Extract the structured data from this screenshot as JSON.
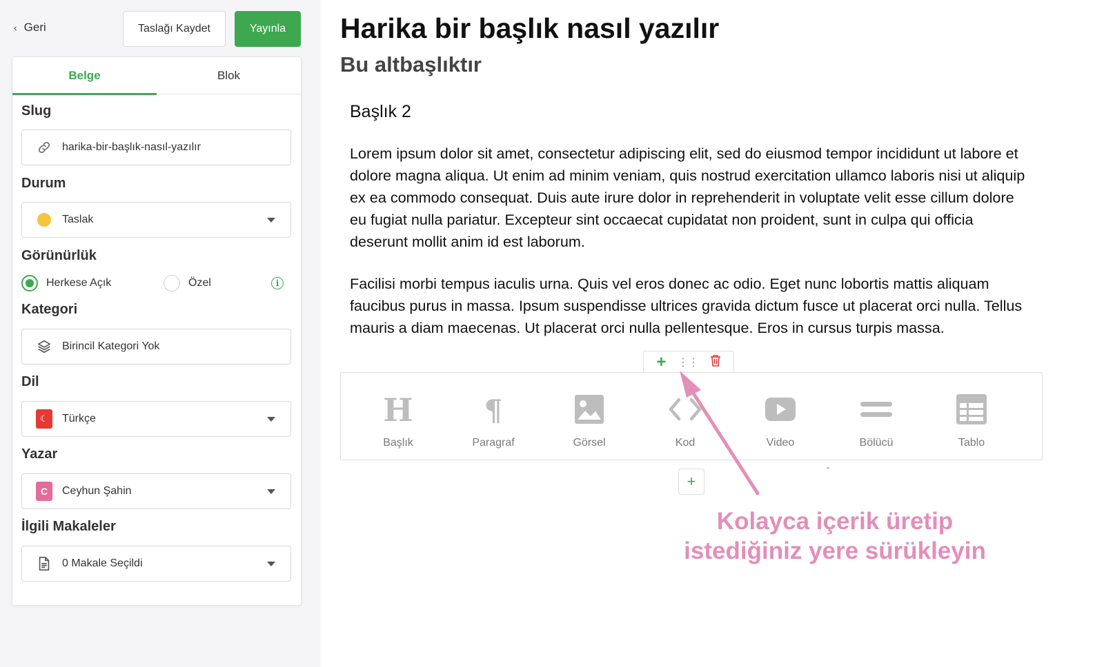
{
  "topbar": {
    "back_label": "Geri",
    "save_draft_label": "Taslağı Kaydet",
    "publish_label": "Yayınla"
  },
  "colors": {
    "accent": "#3ea850",
    "status_draft": "#f7c33b",
    "annotation": "#e28fb9",
    "delete": "#e53935"
  },
  "sidebar": {
    "tabs": [
      {
        "label": "Belge",
        "active": true
      },
      {
        "label": "Blok",
        "active": false
      }
    ],
    "slug": {
      "label": "Slug",
      "icon": "link-icon",
      "value": "harika-bir-başlık-nasıl-yazılır"
    },
    "status": {
      "label": "Durum",
      "icon": "status-dot",
      "value": "Taslak"
    },
    "visibility": {
      "label": "Görünürlük",
      "options": [
        {
          "label": "Herkese Açık",
          "selected": true
        },
        {
          "label": "Özel",
          "selected": false
        }
      ],
      "info_icon": "info-icon"
    },
    "category": {
      "label": "Kategori",
      "icon": "layers-icon",
      "value": "Birincil Kategori Yok"
    },
    "language": {
      "label": "Dil",
      "icon": "turkey-flag-icon",
      "value": "Türkçe"
    },
    "author": {
      "label": "Yazar",
      "avatar_letter": "C",
      "value": "Ceyhun Şahin"
    },
    "related": {
      "label": "İlgili Makaleler",
      "icon": "document-icon",
      "value": "0 Makale Seçildi"
    }
  },
  "editor": {
    "title": "Harika bir başlık nasıl yazılır",
    "subtitle": "Bu altbaşlıktır",
    "heading2": "Başlık 2",
    "paragraph1": "Lorem ipsum dolor sit amet, consectetur adipiscing elit, sed do eiusmod tempor incididunt ut labore et dolore magna aliqua. Ut enim ad minim veniam, quis nostrud exercitation ullamco laboris nisi ut aliquip ex ea commodo consequat. Duis aute irure dolor in reprehenderit in voluptate velit esse cillum dolore eu fugiat nulla pariatur. Excepteur sint occaecat cupidatat non proident, sunt in culpa qui officia deserunt mollit anim id est laborum.",
    "paragraph2": "Facilisi morbi tempus iaculis urna. Quis vel eros donec ac odio. Eget nunc lobortis mattis aliquam faucibus purus in massa. Ipsum suspendisse ultrices gravida dictum fusce ut placerat orci nulla. Tellus mauris a diam maecenas. Ut placerat orci nulla pellentesque. Eros in cursus turpis massa.",
    "block_toolbar": {
      "add_icon": "plus-icon",
      "drag_icon": "drag-handle-icon",
      "delete_icon": "trash-icon"
    },
    "blocks": [
      {
        "label": "Başlık",
        "icon": "heading-icon"
      },
      {
        "label": "Paragraf",
        "icon": "paragraph-icon"
      },
      {
        "label": "Görsel",
        "icon": "image-icon"
      },
      {
        "label": "Kod",
        "icon": "code-icon"
      },
      {
        "label": "Video",
        "icon": "video-icon"
      },
      {
        "label": "Bölücü",
        "icon": "divider-icon"
      },
      {
        "label": "Tablo",
        "icon": "table-icon"
      }
    ],
    "add_block_icon": "plus-icon",
    "annotation": {
      "line1": "Kolayca içerik üretip",
      "line2": "istediğiniz yere sürükleyin"
    }
  }
}
